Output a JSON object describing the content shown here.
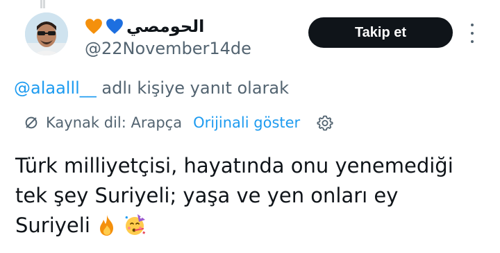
{
  "author": {
    "display_name": "الحومصي",
    "handle": "@22November14de",
    "avatar": "avatar-photo-sunglasses",
    "heart_icons": [
      "orange-heart-icon",
      "blue-heart-icon"
    ]
  },
  "follow_button": {
    "label": "Takip et",
    "color": "#0f1419"
  },
  "reply": {
    "mention": "@alaalll__",
    "suffix": " adlı kişiye yanıt olarak"
  },
  "translation": {
    "source_label": "Kaynak dil: Arapça",
    "show_original": "Orijinali göster"
  },
  "tweet": {
    "line1": "Türk milliyetçisi, hayatında onu yenemediği",
    "line2": "tek şey Suriyeli; yaşa ve yen onları ey",
    "line3": "Suriyeli",
    "emojis": [
      "fire-icon",
      "party-face-icon"
    ]
  },
  "colors": {
    "link": "#1d9bf0",
    "secondary": "#536471",
    "text": "#0f1419"
  }
}
